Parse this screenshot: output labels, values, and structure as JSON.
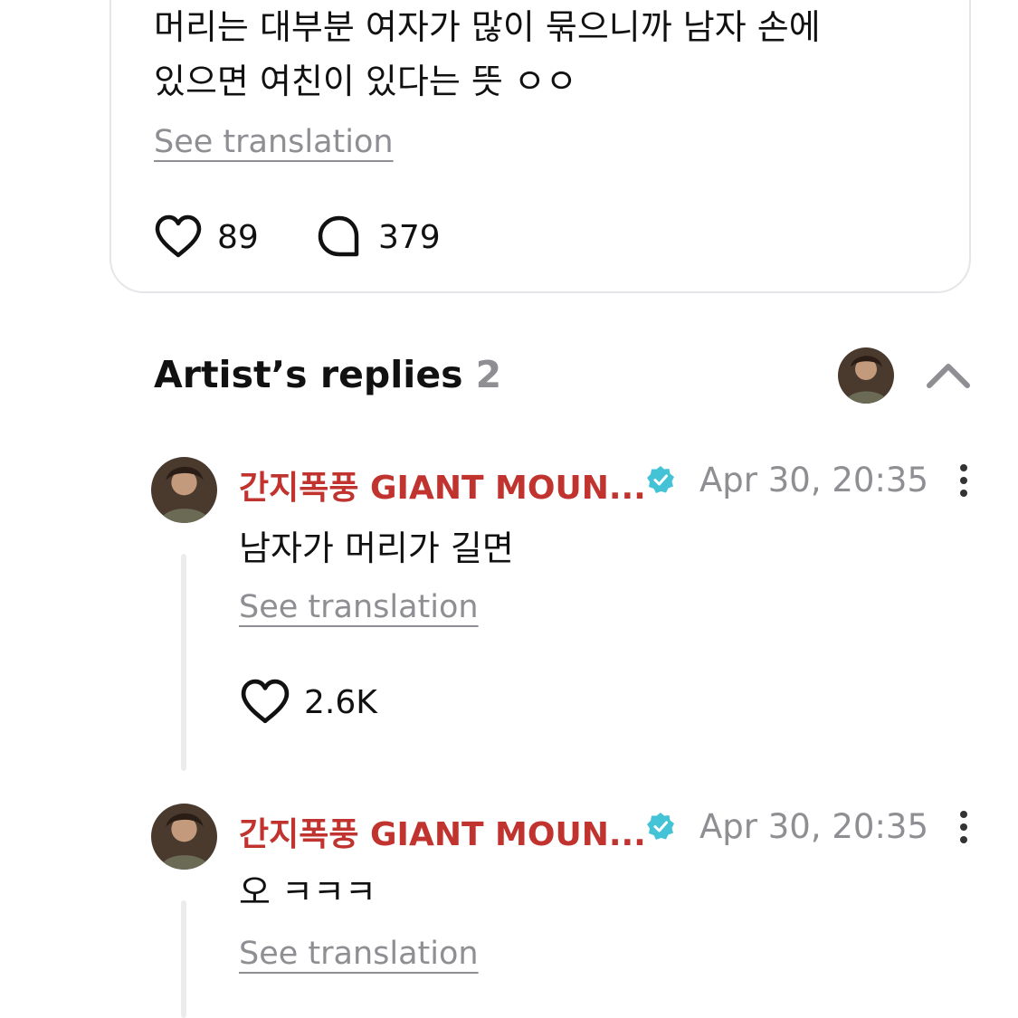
{
  "post": {
    "text_lines": [
      "머리는 대부분 여자가 많이 묶으니까 남자 손에",
      "있으면 여친이 있다는 뜻 ㅇㅇ"
    ],
    "see_translation": "See translation",
    "likes": "89",
    "comments": "379"
  },
  "artist_replies": {
    "title": "Artist’s replies",
    "count": "2",
    "collapse_icon": "chevron-up-icon"
  },
  "replies": [
    {
      "author": "간지폭풍 GIANT MOUN...",
      "verified_icon": "verified-badge-icon",
      "time": "Apr 30, 20:35",
      "text": "남자가 머리가 길면",
      "see_translation": "See translation",
      "likes": "2.6K"
    },
    {
      "author": "간지폭풍 GIANT MOUN...",
      "verified_icon": "verified-badge-icon",
      "time": "Apr 30, 20:35",
      "text": "오 ㅋㅋㅋ",
      "see_translation": "See translation"
    }
  ],
  "colors": {
    "author": "#c0332e",
    "verified": "#45c3d6",
    "muted": "#8e8e93",
    "thread_line": "#ececef",
    "card_border": "#e6e6ea"
  }
}
